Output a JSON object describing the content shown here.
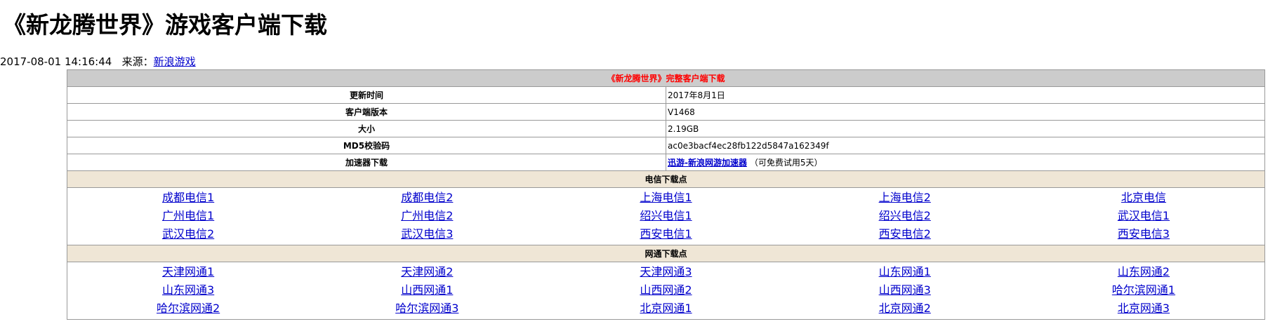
{
  "page": {
    "title": "《新龙腾世界》游戏客户端下载",
    "datetime": "2017-08-01 14:16:44",
    "source_label": "来源：",
    "source_link": "新浪游戏"
  },
  "table": {
    "heading": "《新龙腾世界》完整客户端下载",
    "rows": [
      {
        "label": "更新时间",
        "value": "2017年8月1日"
      },
      {
        "label": "客户端版本",
        "value": "V1468"
      },
      {
        "label": "大小",
        "value": "2.19GB"
      },
      {
        "label": "MD5校验码",
        "value": "ac0e3bacf4ec28fb122d5847a162349f"
      }
    ],
    "accelerator": {
      "label": "加速器下载",
      "link": "迅游-新浪网游加速器",
      "note": "（可免费试用5天）"
    }
  },
  "telecom": {
    "heading": "电信下载点",
    "links": [
      "成都电信1",
      "成都电信2",
      "上海电信1",
      "上海电信2",
      "北京电信",
      "广州电信1",
      "广州电信2",
      "绍兴电信1",
      "绍兴电信2",
      "武汉电信1",
      "武汉电信2",
      "武汉电信3",
      "西安电信1",
      "西安电信2",
      "西安电信3"
    ]
  },
  "netcom": {
    "heading": "网通下载点",
    "links": [
      "天津网通1",
      "天津网通2",
      "天津网通3",
      "山东网通1",
      "山东网通2",
      "山东网通3",
      "山西网通1",
      "山西网通2",
      "山西网通3",
      "哈尔滨网通1",
      "哈尔滨网通2",
      "哈尔滨网通3",
      "北京网通1",
      "北京网通2",
      "北京网通3"
    ]
  }
}
